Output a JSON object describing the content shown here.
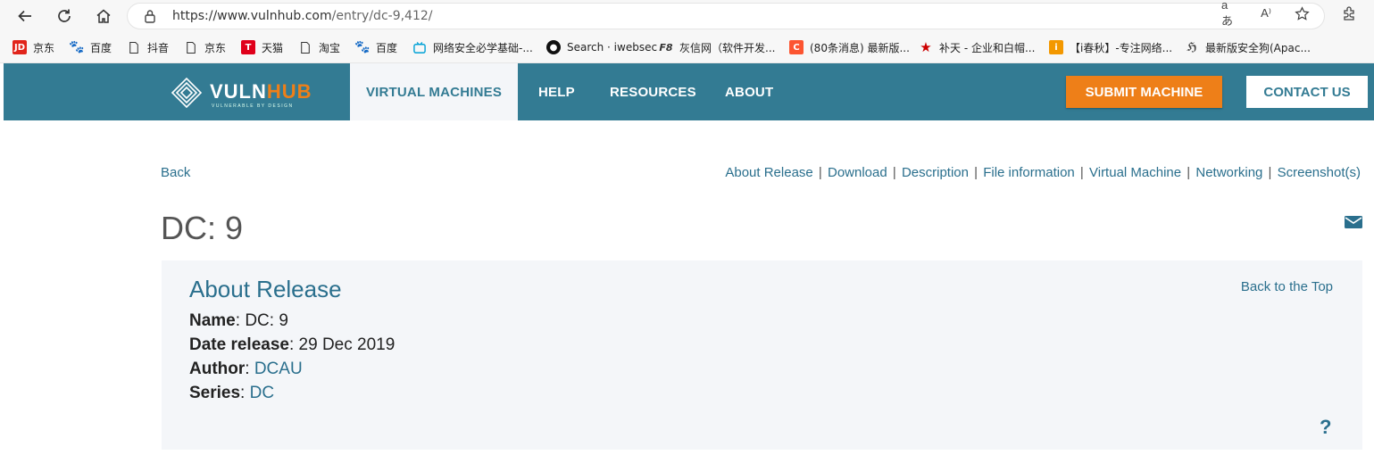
{
  "browser": {
    "url_prefix": "https://www.vulnhub.com",
    "url_path": "/entry/dc-9,412/",
    "read_aloud_icon": "read-aloud-icon",
    "translate_icon": "translate-icon"
  },
  "bookmarks": [
    {
      "label": "京东",
      "icon": "JD",
      "color": "#e1251b"
    },
    {
      "label": "百度",
      "icon": "paw",
      "color": "#2932e1"
    },
    {
      "label": "抖音",
      "icon": "page",
      "color": ""
    },
    {
      "label": "京东",
      "icon": "page",
      "color": ""
    },
    {
      "label": "天猫",
      "icon": "T",
      "color": "#e0001b"
    },
    {
      "label": "淘宝",
      "icon": "page",
      "color": ""
    },
    {
      "label": "百度",
      "icon": "paw",
      "color": "#2932e1"
    },
    {
      "label": "网络安全必学基础-...",
      "icon": "tv",
      "color": "#00a1d6"
    },
    {
      "label": "Search · iwebsec",
      "icon": "github",
      "color": "#111"
    },
    {
      "label": "灰信网（软件开发...",
      "icon": "F8",
      "color": "#333"
    },
    {
      "label": "(80条消息) 最新版...",
      "icon": "C",
      "color": "#fc5531"
    },
    {
      "label": "补天 - 企业和白帽...",
      "icon": "star",
      "color": "#c00"
    },
    {
      "label": "【i春秋】-专注网络...",
      "icon": "i",
      "color": "#f39800"
    },
    {
      "label": "最新版安全狗(Apac...",
      "icon": "dog",
      "color": "#444"
    }
  ],
  "header": {
    "logo_text": "VULNHUB",
    "logo_tagline": "VULNERABLE BY DESIGN",
    "nav": [
      "VIRTUAL MACHINES",
      "HELP",
      "RESOURCES",
      "ABOUT"
    ],
    "submit": "SUBMIT MACHINE",
    "contact": "CONTACT US"
  },
  "page": {
    "back": "Back",
    "section_nav": [
      "About Release",
      "Download",
      "Description",
      "File information",
      "Virtual Machine",
      "Networking",
      "Screenshot(s)"
    ],
    "title": "DC: 9"
  },
  "about": {
    "heading": "About Release",
    "back_to_top": "Back to the Top",
    "name_label": "Name",
    "name_value": "DC: 9",
    "date_label": "Date release",
    "date_value": "29 Dec 2019",
    "author_label": "Author",
    "author_value": "DCAU",
    "series_label": "Series",
    "series_value": "DC",
    "help_symbol": "?"
  },
  "colors": {
    "header_bg": "#337b93",
    "accent_orange": "#ee7f18",
    "link": "#2a6f8d",
    "panel_bg": "#f4f6f9"
  }
}
